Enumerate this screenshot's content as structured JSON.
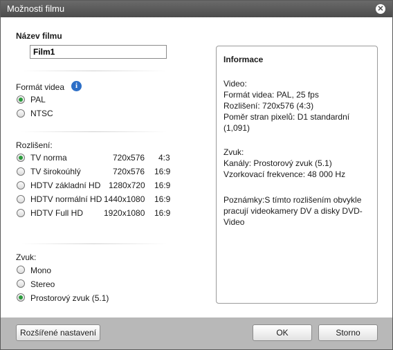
{
  "title": "Možnosti filmu",
  "close_glyph": "✕",
  "movie_name": {
    "label": "Název filmu",
    "value": "Film1"
  },
  "video_format": {
    "label": "Formát videa",
    "info_icon": "i",
    "options": [
      {
        "label": "PAL",
        "selected": true
      },
      {
        "label": "NTSC",
        "selected": false
      }
    ]
  },
  "resolution": {
    "label": "Rozlišení:",
    "options": [
      {
        "name": "TV norma",
        "size": "720x576",
        "ratio": "4:3",
        "selected": true
      },
      {
        "name": "TV širokoúhlý",
        "size": "720x576",
        "ratio": "16:9",
        "selected": false
      },
      {
        "name": "HDTV základní HD",
        "size": "1280x720",
        "ratio": "16:9",
        "selected": false
      },
      {
        "name": "HDTV normální HD",
        "size": "1440x1080",
        "ratio": "16:9",
        "selected": false
      },
      {
        "name": "HDTV Full HD",
        "size": "1920x1080",
        "ratio": "16:9",
        "selected": false
      }
    ]
  },
  "sound": {
    "label": "Zvuk:",
    "options": [
      {
        "label": "Mono",
        "selected": false
      },
      {
        "label": "Stereo",
        "selected": false
      },
      {
        "label": "Prostorový zvuk (5.1)",
        "selected": true
      }
    ]
  },
  "info": {
    "heading": "Informace",
    "video_title": "Video:",
    "video_format": "Formát videa: PAL, 25 fps",
    "video_resolution": "Rozlišení: 720x576 (4:3)",
    "pixel_ratio": "Poměr stran pixelů: D1 standardní (1,091)",
    "audio_title": "Zvuk:",
    "channels": "Kanály: Prostorový zvuk (5.1)",
    "sample_rate": "Vzorkovací frekvence: 48 000 Hz",
    "notes": "Poznámky:S tímto rozlišením obvykle pracují videokamery DV a disky DVD-Video"
  },
  "buttons": {
    "advanced": "Rozšířené nastavení",
    "ok": "OK",
    "cancel": "Storno"
  },
  "colors": {
    "titlebar": "#555555",
    "footer": "#b8b8b8",
    "radio_selected": "#2a9a3c",
    "info_icon": "#2d6fc7"
  }
}
